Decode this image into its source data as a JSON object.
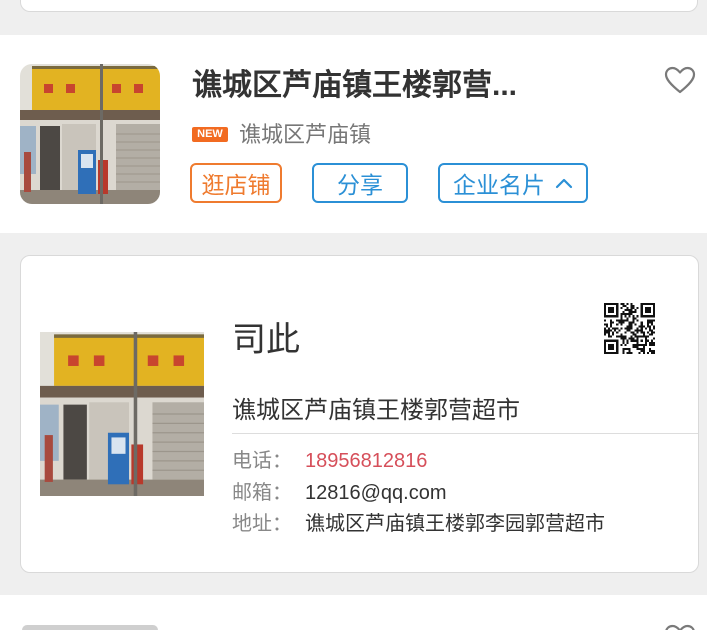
{
  "colors": {
    "page_bg": "#efefef",
    "title": "#333333",
    "muted": "#777777",
    "label": "#888888",
    "accent_orange": "#ef7b2f",
    "accent_blue": "#2b90d6",
    "phone": "#d64f5a",
    "badge_bg": "#f26b21",
    "border": "#d9d9d9"
  },
  "store": {
    "thumbnail": "store-photo",
    "title": "谯城区芦庙镇王楼郭营...",
    "favorite_icon": "heart-outline-icon",
    "badge": "NEW",
    "location": "谯城区芦庙镇",
    "actions": {
      "visit_store": "逛店铺",
      "share": "分享",
      "business_card": "企业名片",
      "business_card_icon": "chevron-up-icon"
    }
  },
  "business_card": {
    "photo": "store-photo",
    "contact_name": "司此",
    "qr_icon": "qr-code",
    "company": "谯城区芦庙镇王楼郭营超市",
    "phone_label": "电话：",
    "phone": "18956812816",
    "email_label": "邮箱：",
    "email": "12816@qq.com",
    "address_label": "地址：",
    "address": "谯城区芦庙镇王楼郭李园郭营超市"
  },
  "next_store": {
    "favorite_icon": "heart-outline-icon"
  }
}
